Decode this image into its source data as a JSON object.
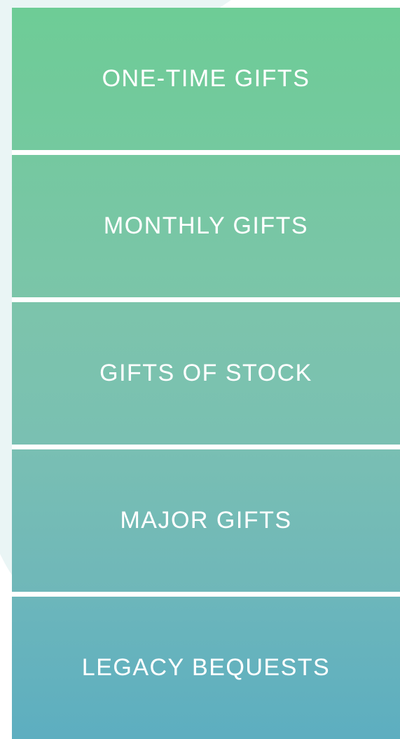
{
  "gift_options": [
    {
      "label": "ONE-TIME GIFTS",
      "color_top": "#6ecc96",
      "color_bottom": "#74c99f"
    },
    {
      "label": "MONTHLY GIFTS",
      "color_top": "#75c8a0",
      "color_bottom": "#7bc5a9"
    },
    {
      "label": "GIFTS OF STOCK",
      "color_top": "#7cc4ab",
      "color_bottom": "#7ac0b2"
    },
    {
      "label": "MAJOR GIFTS",
      "color_top": "#79bfb3",
      "color_bottom": "#6fb7b9"
    },
    {
      "label": "LEGACY BEQUESTS",
      "color_top": "#6cb6bb",
      "color_bottom": "#5daec0"
    }
  ],
  "colors": {
    "background": "#ffffff",
    "backdrop_shape": "#eaf5f5",
    "label_text": "#ffffff"
  }
}
